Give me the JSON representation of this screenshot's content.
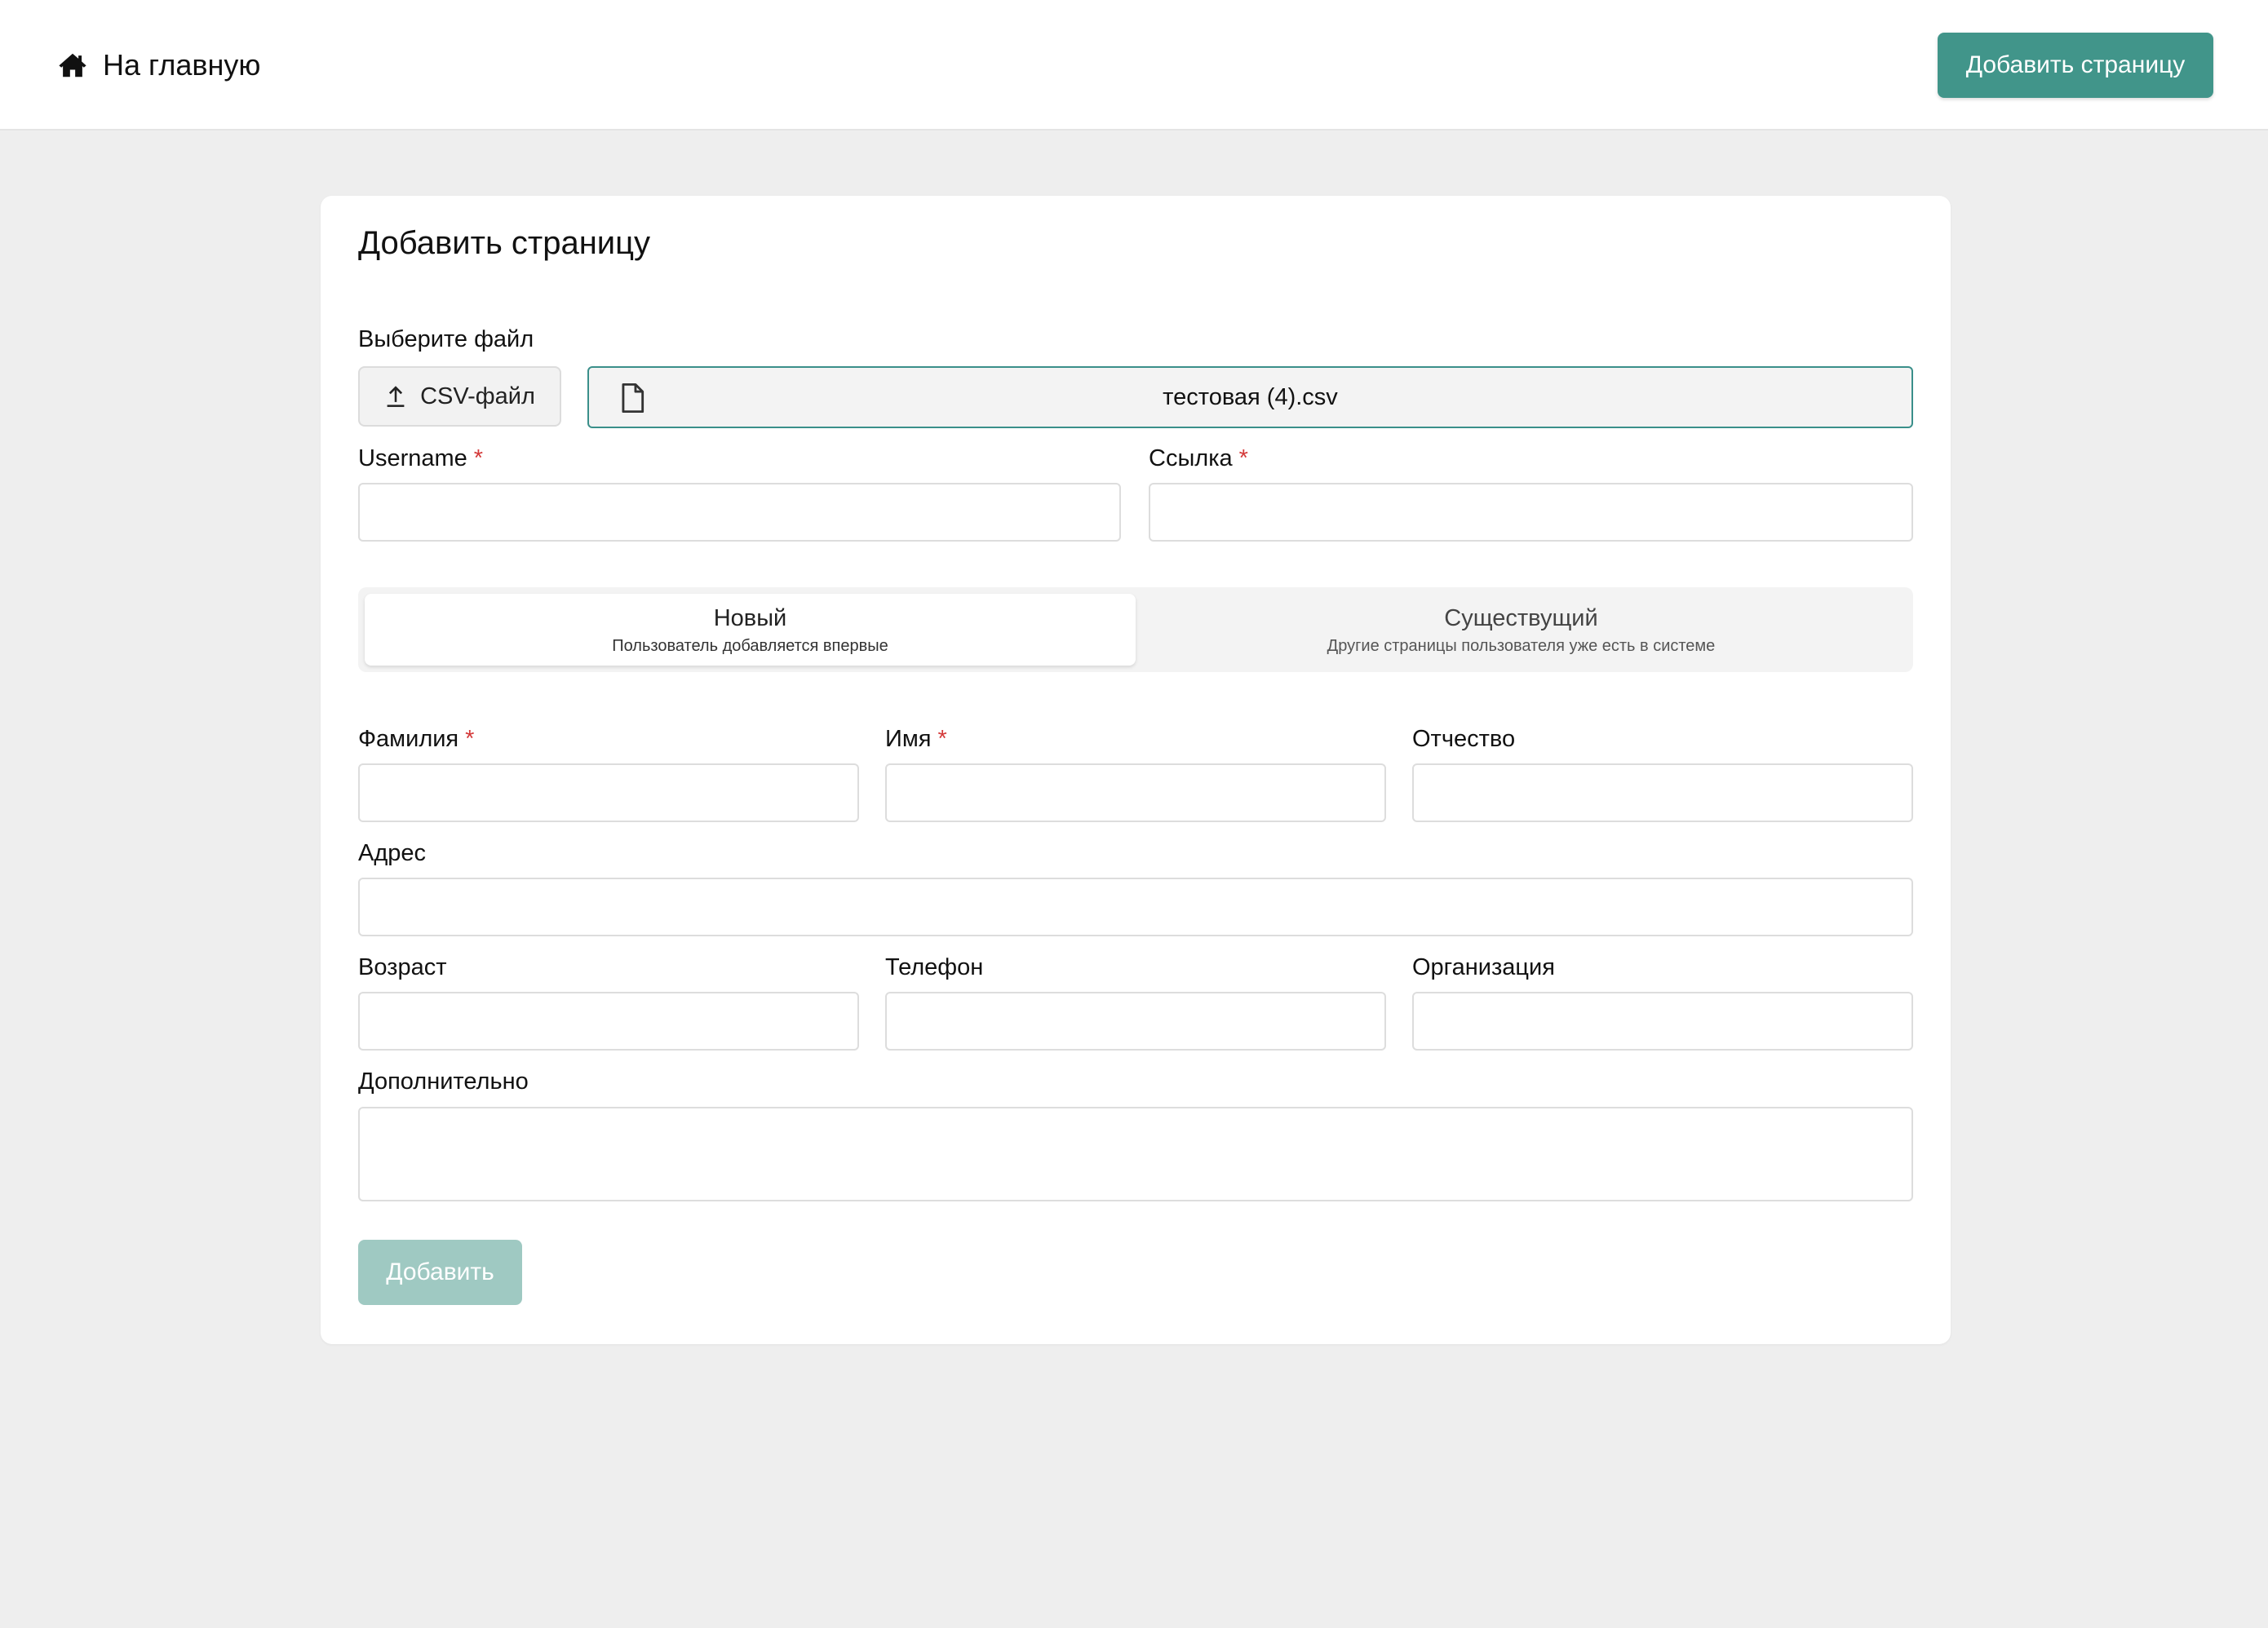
{
  "header": {
    "home_label": "На главную",
    "add_page_button": "Добавить страницу"
  },
  "form": {
    "title": "Добавить страницу",
    "file_label": "Выберите файл",
    "csv_button": "CSV-файл",
    "file_name": "тестовая (4).csv",
    "username_label": "Username",
    "link_label": "Ссылка",
    "required_mark": "*",
    "segment": {
      "new": {
        "title": "Новый",
        "subtitle": "Пользователь добавляется впервые"
      },
      "existing": {
        "title": "Существущий",
        "subtitle": "Другие страницы пользователя уже есть в системе"
      },
      "selected": "new"
    },
    "lastname_label": "Фамилия",
    "firstname_label": "Имя",
    "patronymic_label": "Отчество",
    "address_label": "Адрес",
    "age_label": "Возраст",
    "phone_label": "Телефон",
    "organization_label": "Организация",
    "extra_label": "Дополнительно",
    "submit_button": "Добавить"
  },
  "icons": {
    "home": "home-icon",
    "upload": "upload-icon",
    "file": "file-icon"
  },
  "colors": {
    "accent": "#41958a",
    "accent_disabled": "#9fc9c2",
    "required": "#d43a3a",
    "focus_border": "#3a8f8a"
  }
}
